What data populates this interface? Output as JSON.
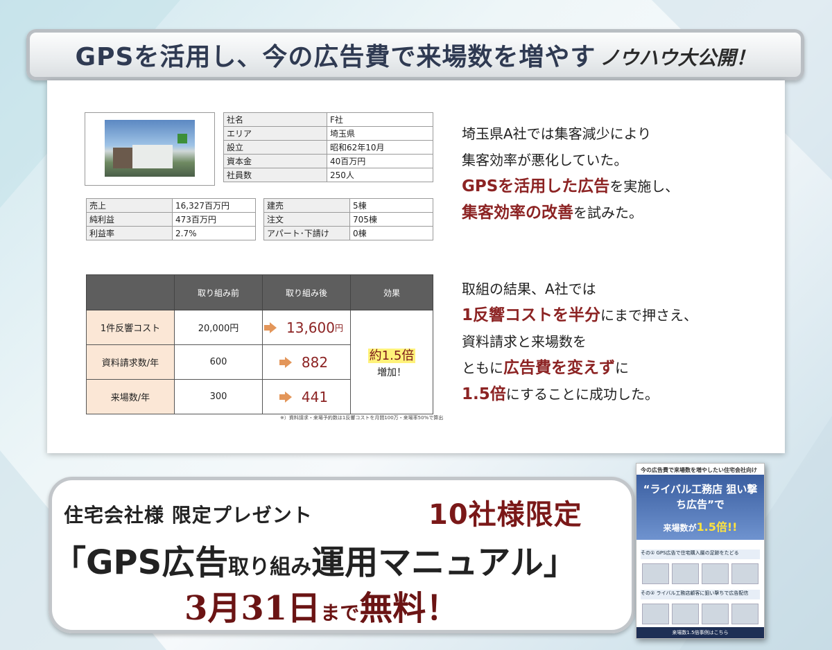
{
  "headline": {
    "main": "GPSを活用し、今の広告費で来場数を増やす",
    "sub": "ノウハウ大公開！"
  },
  "company_info": [
    {
      "key": "社名",
      "value": "F社"
    },
    {
      "key": "エリア",
      "value": "埼玉県"
    },
    {
      "key": "設立",
      "value": "昭和62年10月"
    },
    {
      "key": "資本金",
      "value": "40百万円"
    },
    {
      "key": "社員数",
      "value": "250人"
    }
  ],
  "finance": [
    {
      "key": "売上",
      "value": "16,327百万円"
    },
    {
      "key": "純利益",
      "value": "473百万円"
    },
    {
      "key": "利益率",
      "value": "2.7%"
    }
  ],
  "sales": [
    {
      "key": "建売",
      "value": "5棟"
    },
    {
      "key": "注文",
      "value": "705棟"
    },
    {
      "key": "アパート･下請け",
      "value": "0棟"
    }
  ],
  "results": {
    "headers": [
      "",
      "取り組み前",
      "取り組み後",
      "効果"
    ],
    "rows": [
      {
        "label": "1件反響コスト",
        "before": "20,000円",
        "after": "13,600",
        "after_unit": "円"
      },
      {
        "label": "資料請求数/年",
        "before": "600",
        "after": "882",
        "after_unit": ""
      },
      {
        "label": "来場数/年",
        "before": "300",
        "after": "441",
        "after_unit": ""
      }
    ],
    "effect_main": "約1.5倍",
    "effect_sub": "増加！",
    "note": "※）資料請求・来場予約数は1反響コストを月間100万・来場率50%で算出"
  },
  "copy1": {
    "l1": "埼玉県A社では集客減少により",
    "l2": "集客効率が悪化していた。",
    "l3_em": "GPSを活用した広告",
    "l3": "を実施し、",
    "l4_em": "集客効率の改善",
    "l4": "を試みた。"
  },
  "copy2": {
    "l1": "取組の結果、A社では",
    "l2_em": "1反響コストを半分",
    "l2": "にまで押さえ、",
    "l3": "資料請求と来場数を",
    "l4": "ともに",
    "l4_em": "広告費を変えず",
    "l4b": "に",
    "l5_em": "1.5倍",
    "l5": "にすることに成功した。"
  },
  "promo": {
    "line1": "住宅会社様 限定プレゼント",
    "line1b": "10社様限定",
    "line2a": "「GPS広告",
    "line2b": "取り組み",
    "line2c": "運用マニュアル」",
    "line3a": "3月31日",
    "line3b": "まで",
    "line3c": "無料！"
  },
  "booklet": {
    "top": "今の広告費で来場数を増やしたい住宅会社向け",
    "title": "“ライバル工務店 狙い撃ち広告”で",
    "sub": "来場数が",
    "sub_em": "1.5倍!!",
    "sec1": "その① GPS広告で住宅購入層の足跡をたどる",
    "sec2": "その② ライバル工務店顧客に狙い撃ちで広告配信",
    "foot": "来場数1.5倍事例はこちら"
  }
}
